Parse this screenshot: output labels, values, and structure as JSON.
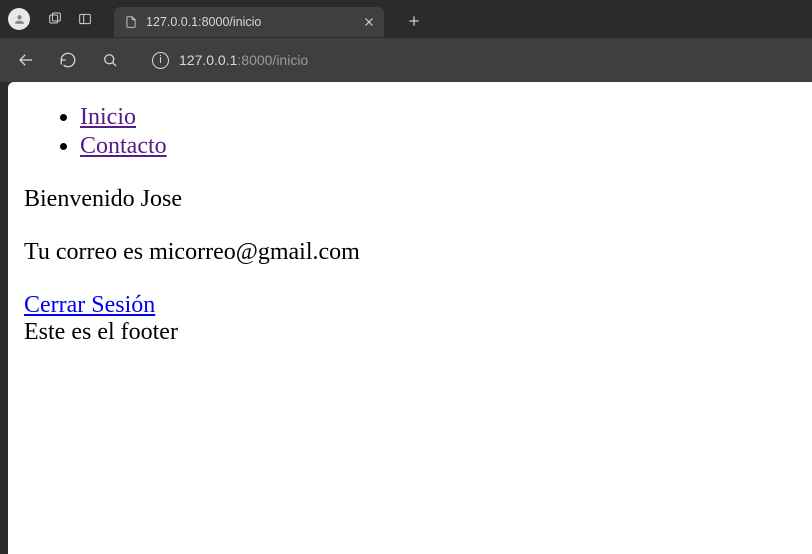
{
  "browser": {
    "tab_title": "127.0.0.1:8000/inicio",
    "url_host": "127.0.0.1",
    "url_port_path": ":8000/inicio"
  },
  "nav": {
    "items": [
      {
        "label": "Inicio"
      },
      {
        "label": "Contacto"
      }
    ]
  },
  "content": {
    "welcome": "Bienvenido Jose",
    "email_line": "Tu correo es micorreo@gmail.com",
    "logout_label": "Cerrar Sesión",
    "footer_text": "Este es el footer"
  }
}
